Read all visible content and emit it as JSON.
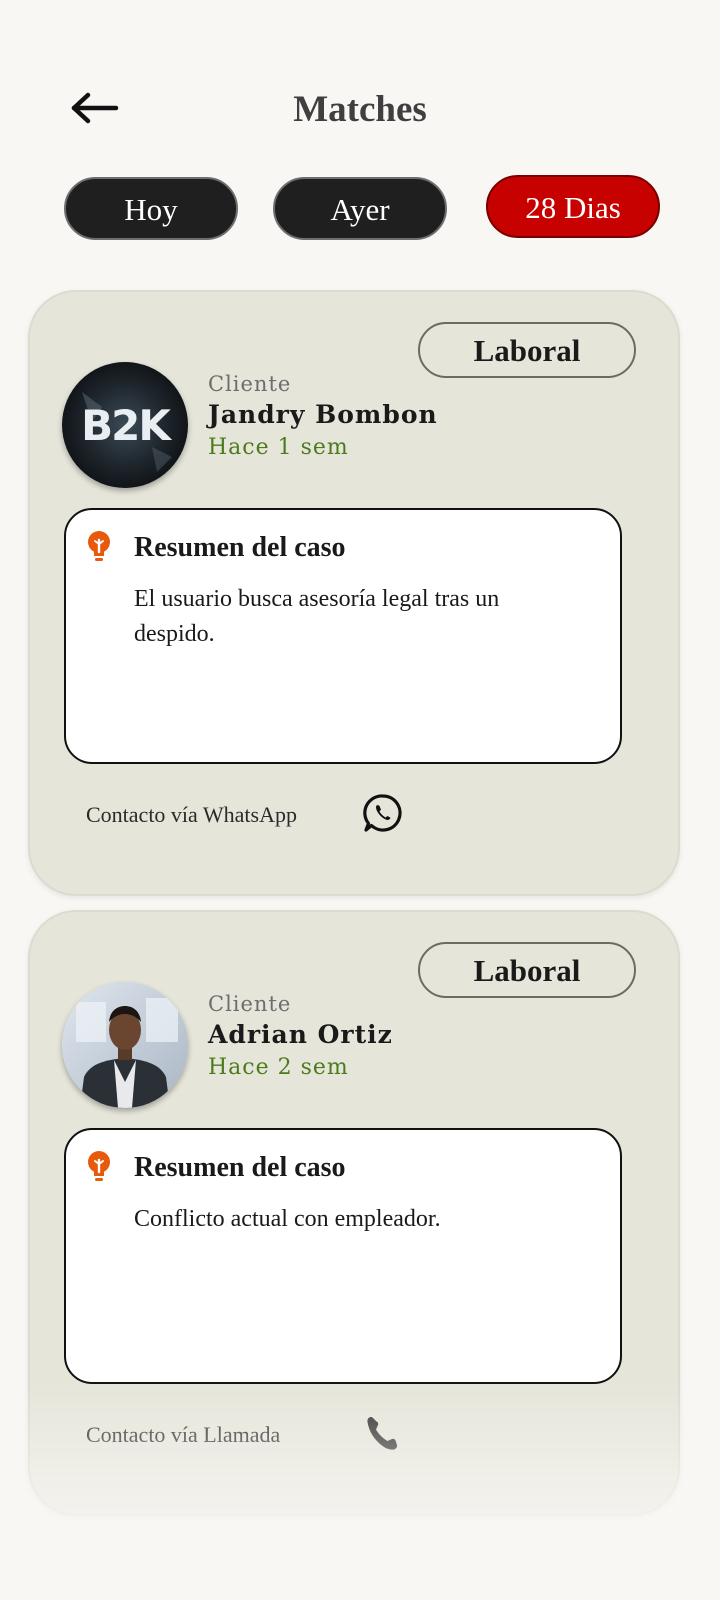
{
  "header": {
    "title": "Matches",
    "back_icon": "arrow-left-icon"
  },
  "filters": [
    {
      "label": "Hoy",
      "active": false
    },
    {
      "label": "Ayer",
      "active": false
    },
    {
      "label": "28 Dias",
      "active": true
    }
  ],
  "colors": {
    "active_filter": "#c70000",
    "inactive_filter": "#1f1f1f",
    "card_bg": "#e6e5da",
    "time_green": "#4d7a1d",
    "bulb_orange": "#e8590c"
  },
  "cards": [
    {
      "tag": "Laboral",
      "client_label": "Cliente",
      "client_name": "Jandry Bombon",
      "time_ago": "Hace 1 sem",
      "avatar_text": "B2K",
      "summary_title": "Resumen del caso",
      "summary_text": "El usuario busca asesoría legal tras un despido.",
      "contact_text": "Contacto vía WhatsApp",
      "contact_icon": "whatsapp-icon"
    },
    {
      "tag": "Laboral",
      "client_label": "Cliente",
      "client_name": "Adrian Ortiz",
      "time_ago": "Hace 2 sem",
      "summary_title": "Resumen del caso",
      "summary_text": "Conflicto actual con empleador.",
      "contact_text": "Contacto vía Llamada",
      "contact_icon": "phone-icon"
    }
  ]
}
